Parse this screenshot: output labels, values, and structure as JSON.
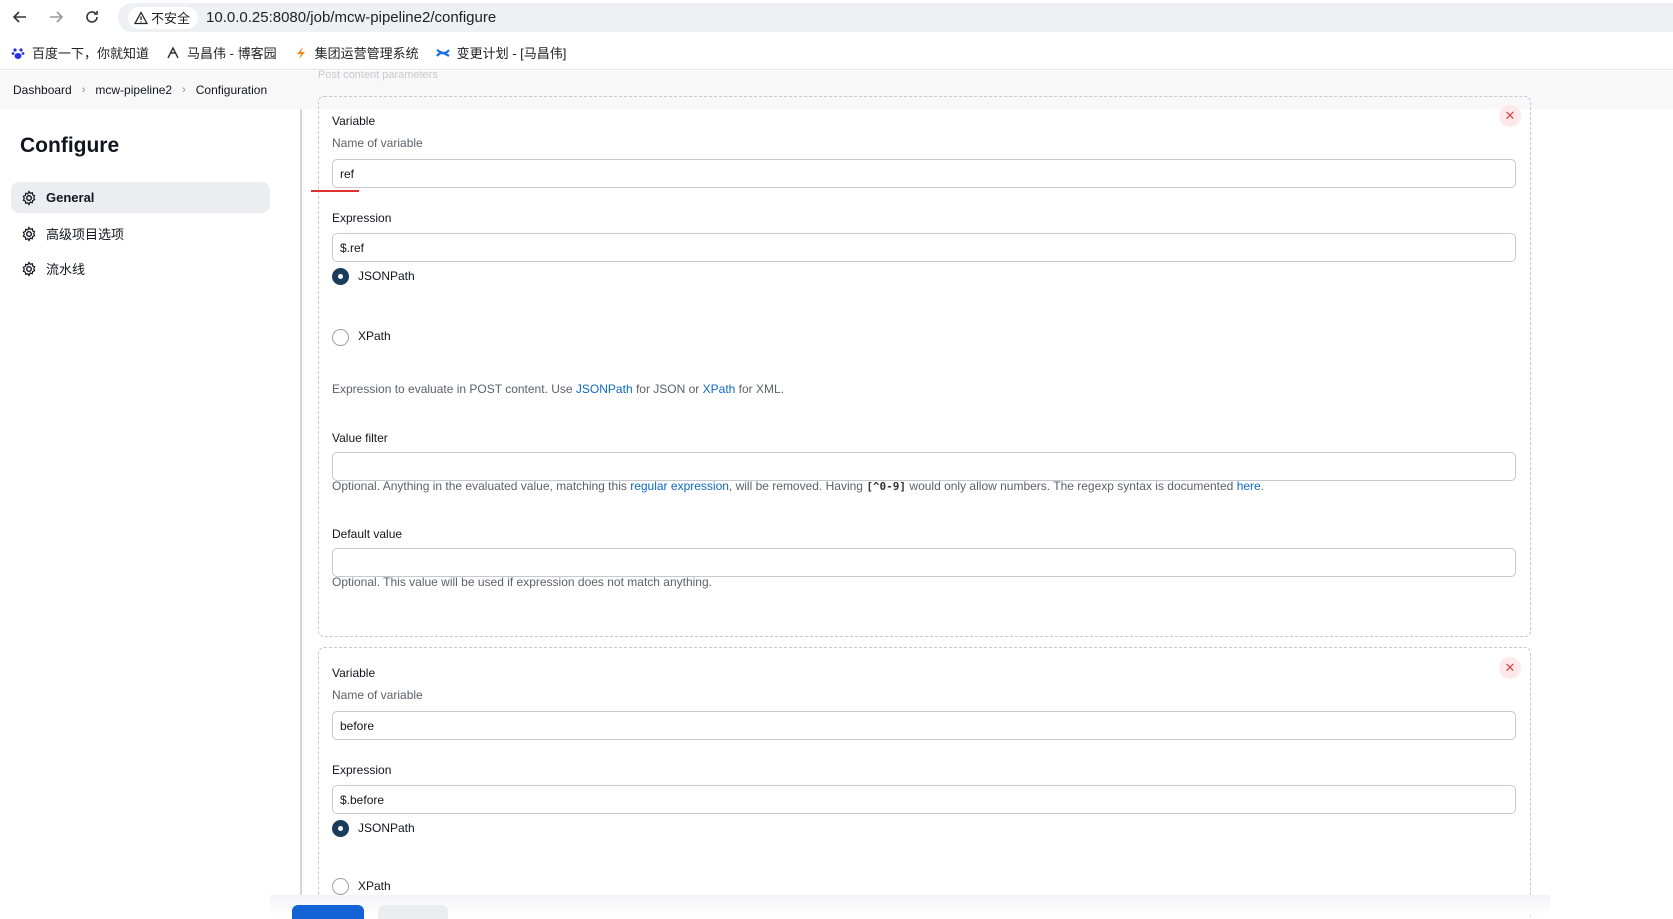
{
  "browser": {
    "security_label": "不安全",
    "url": "10.0.0.25:8080/job/mcw-pipeline2/configure",
    "bookmarks": [
      {
        "label": "百度一下，你就知道",
        "icon": "baidu-paw-icon"
      },
      {
        "label": "马昌伟 - 博客园",
        "icon": "cnblogs-icon"
      },
      {
        "label": "集团运营管理系统",
        "icon": "lightning-icon"
      },
      {
        "label": "变更计划 - [马昌伟]",
        "icon": "confluence-icon"
      }
    ]
  },
  "breadcrumb": {
    "items": [
      "Dashboard",
      "mcw-pipeline2",
      "Configuration"
    ],
    "faded_section": "Post content parameters"
  },
  "sidebar": {
    "title": "Configure",
    "items": [
      {
        "label": "General",
        "active": true
      },
      {
        "label": "高级项目选项",
        "active": false
      },
      {
        "label": "流水线",
        "active": false
      }
    ]
  },
  "params": [
    {
      "variable_label": "Variable",
      "variable_hint": "Name of variable",
      "variable_value": "ref",
      "expression_label": "Expression",
      "expression_value": "$.ref",
      "option_jsonpath": "JSONPath",
      "option_xpath": "XPath",
      "selected": "JSONPath",
      "help_pre": "Expression to evaluate in POST content. Use ",
      "help_link1": "JSONPath",
      "help_mid": " for JSON or ",
      "help_link2": "XPath",
      "help_post": " for XML.",
      "value_filter_label": "Value filter",
      "value_filter_value": "",
      "vf_help_pre": "Optional. Anything in the evaluated value, matching this ",
      "vf_help_link": "regular expression",
      "vf_help_mid": ", will be removed. Having ",
      "vf_help_code": "[^0-9]",
      "vf_help_mid2": " would only allow numbers. The regexp syntax is documented ",
      "vf_help_link2": "here",
      "vf_help_end": ".",
      "default_label": "Default value",
      "default_value": "",
      "default_help": "Optional. This value will be used if expression does not match anything."
    },
    {
      "variable_label": "Variable",
      "variable_hint": "Name of variable",
      "variable_value": "before",
      "expression_label": "Expression",
      "expression_value": "$.before",
      "option_jsonpath": "JSONPath",
      "option_xpath": "XPath",
      "selected": "JSONPath"
    }
  ],
  "colors": {
    "accent": "#1463d6",
    "radio_selected": "#1a3d5d",
    "link": "#0f69c7",
    "delete": "#e0424d"
  }
}
